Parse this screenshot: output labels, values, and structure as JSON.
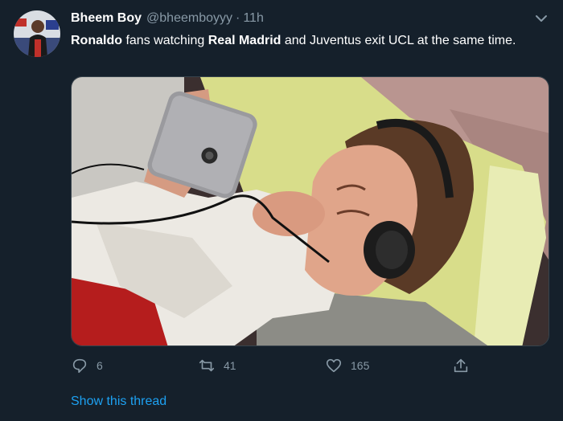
{
  "tweet": {
    "author_name": "Bheem Boy",
    "author_handle": "@bheemboyyy",
    "separator": "·",
    "time": "11h",
    "text_parts": [
      {
        "text": "Ronaldo",
        "bold": true
      },
      {
        "text": " fans watching ",
        "bold": false
      },
      {
        "text": "Real Madrid",
        "bold": true
      },
      {
        "text": " and Juventus exit UCL at the same time.",
        "bold": false
      }
    ]
  },
  "actions": {
    "reply_count": "6",
    "retweet_count": "41",
    "like_count": "165"
  },
  "show_thread_label": "Show this thread",
  "icons": {
    "reply": "reply-icon",
    "retweet": "retweet-icon",
    "like": "heart-icon",
    "share": "share-icon",
    "more": "chevron-down-icon"
  },
  "colors": {
    "background": "#15202b",
    "secondary_text": "#8899a6",
    "link": "#1da1f2"
  }
}
